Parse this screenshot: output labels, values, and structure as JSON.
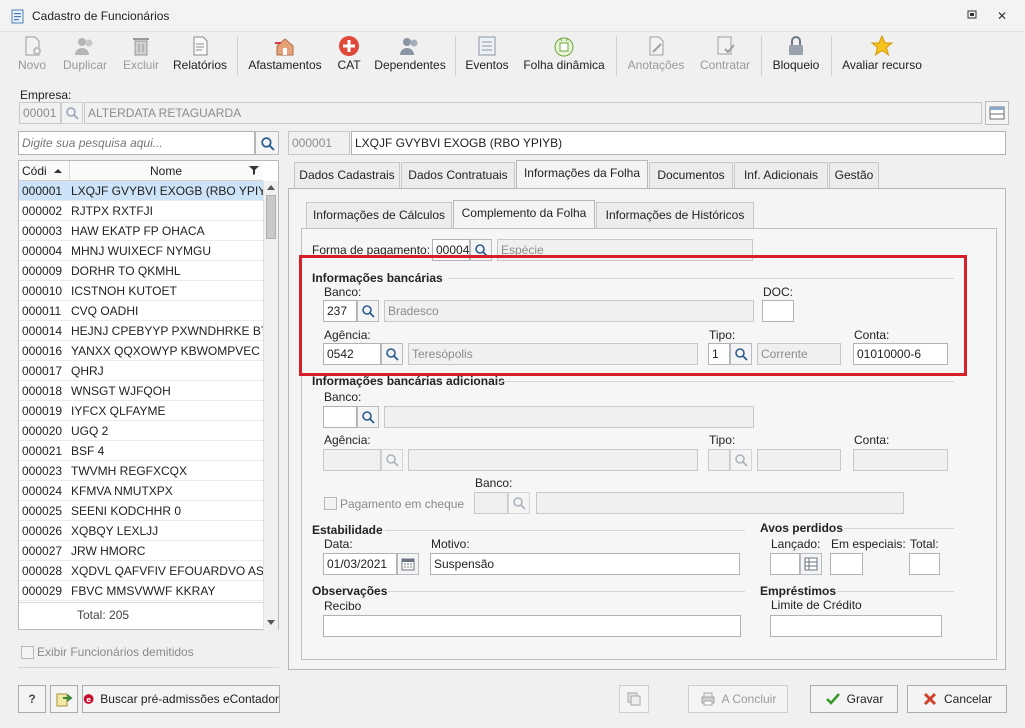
{
  "window": {
    "title": "Cadastro de Funcionários",
    "restore_icon": "restore-icon",
    "close_glyph": "✕"
  },
  "toolbar": {
    "items": [
      {
        "label": "Novo",
        "icon": "new-document-icon",
        "enabled": false
      },
      {
        "label": "Duplicar",
        "icon": "users-icon",
        "enabled": false
      },
      {
        "label": "Excluir",
        "icon": "trash-icon",
        "enabled": false
      },
      {
        "label": "Relatórios",
        "icon": "report-icon",
        "enabled": true
      },
      {
        "label": "Afastamentos",
        "icon": "house-arrow-icon",
        "enabled": true
      },
      {
        "label": "CAT",
        "icon": "medical-cross-icon",
        "enabled": true
      },
      {
        "label": "Dependentes",
        "icon": "people-icon",
        "enabled": true
      },
      {
        "label": "Eventos",
        "icon": "list-icon",
        "enabled": true
      },
      {
        "label": "Folha dinâmica",
        "icon": "calendar-refresh-icon",
        "enabled": true
      },
      {
        "label": "Anotações",
        "icon": "note-pen-icon",
        "enabled": false
      },
      {
        "label": "Contratar",
        "icon": "contract-check-icon",
        "enabled": false
      },
      {
        "label": "Bloqueio",
        "icon": "lock-icon",
        "enabled": true
      },
      {
        "label": "Avaliar recurso",
        "icon": "star-icon",
        "enabled": true
      }
    ]
  },
  "empresa": {
    "label": "Empresa:",
    "code": "00001",
    "name": "ALTERDATA RETAGUARDA"
  },
  "search": {
    "placeholder": "Digite sua pesquisa aqui..."
  },
  "selected": {
    "code": "000001",
    "name": "LXQJF GVYBVI EXOGB (RBO YPIYB)"
  },
  "list": {
    "col_code": "Códi",
    "col_name": "Nome",
    "rows": [
      {
        "code": "000001",
        "name": "LXQJF GVYBVI EXOGB (RBO YPIYB)"
      },
      {
        "code": "000002",
        "name": "RJTPX RXTFJI"
      },
      {
        "code": "000003",
        "name": "HAW EKATP FP OHACA"
      },
      {
        "code": "000004",
        "name": "MHNJ WUIXECF NYMGU"
      },
      {
        "code": "000009",
        "name": "DORHR TO QKMHL"
      },
      {
        "code": "000010",
        "name": "ICSTNOH KUTOET"
      },
      {
        "code": "000011",
        "name": "CVQ OADHI"
      },
      {
        "code": "000014",
        "name": "HEJNJ CPEBYYP PXWNDHRKE BTB J"
      },
      {
        "code": "000016",
        "name": "YANXX QQXOWYP KBWOMPVEC A"
      },
      {
        "code": "000017",
        "name": "QHRJ"
      },
      {
        "code": "000018",
        "name": "WNSGT WJFQOH"
      },
      {
        "code": "000019",
        "name": "IYFCX QLFAYME"
      },
      {
        "code": "000020",
        "name": "UGQ 2"
      },
      {
        "code": "000021",
        "name": "BSF 4"
      },
      {
        "code": "000023",
        "name": "TWVMH REGFXCQX"
      },
      {
        "code": "000024",
        "name": "KFMVA NMUTXPX"
      },
      {
        "code": "000025",
        "name": "SEENI KODCHHR 0"
      },
      {
        "code": "000026",
        "name": "XQBQY LEXLJJ"
      },
      {
        "code": "000027",
        "name": "JRW HMORC"
      },
      {
        "code": "000028",
        "name": "XQDVL QAFVFIV EFOUARDVO AST U"
      },
      {
        "code": "000029",
        "name": "FBVC MMSVWWF KKRAY"
      }
    ],
    "total": "Total: 205"
  },
  "show_dismissed": "Exibir Funcionários demitidos",
  "tabs": [
    "Dados Cadastrais",
    "Dados Contratuais",
    "Informações da Folha",
    "Documentos",
    "Inf. Adicionais",
    "Gestão"
  ],
  "subtabs": [
    "Informações de Cálculos",
    "Complemento da Folha",
    "Informações de  Históricos"
  ],
  "form": {
    "pagamento": {
      "label": "Forma de pagamento:",
      "code": "00004",
      "placeholder": "Espécie"
    },
    "bancarias": {
      "title": "Informações bancárias",
      "banco_label": "Banco:",
      "banco_code": "237",
      "banco_name": "Bradesco",
      "doc_label": "DOC:",
      "doc_value": "",
      "agencia_label": "Agência:",
      "agencia_code": "0542",
      "agencia_name": "Teresópolis",
      "tipo_label": "Tipo:",
      "tipo_code": "1",
      "tipo_name": "Corrente",
      "conta_label": "Conta:",
      "conta_value": "01010000-6"
    },
    "adicionais": {
      "title": "Informações bancárias adicionais",
      "banco_label": "Banco:",
      "agencia_label": "Agência:",
      "tipo_label": "Tipo:",
      "conta_label": "Conta:",
      "cheque_label": "Pagamento em cheque",
      "banco2_label": "Banco:"
    },
    "estabilidade": {
      "title": "Estabilidade",
      "data_label": "Data:",
      "data_value": "01/03/2021",
      "motivo_label": "Motivo:",
      "motivo_value": "Suspensão"
    },
    "avos": {
      "title": "Avos perdidos",
      "lancado_label": "Lançado:",
      "especiais_label": "Em especiais:",
      "total_label": "Total:"
    },
    "observacoes": {
      "title": "Observações",
      "recibo_label": "Recibo"
    },
    "emprestimos": {
      "title": "Empréstimos",
      "limite_label": "Limite de Crédito"
    }
  },
  "footer": {
    "help": "?",
    "buscar": "Buscar pré-admissões eContador",
    "concluir": "A Concluir",
    "gravar": "Gravar",
    "cancelar": "Cancelar"
  },
  "colors": {
    "highlight": "#d7202a",
    "selection": "#cde3f7"
  }
}
